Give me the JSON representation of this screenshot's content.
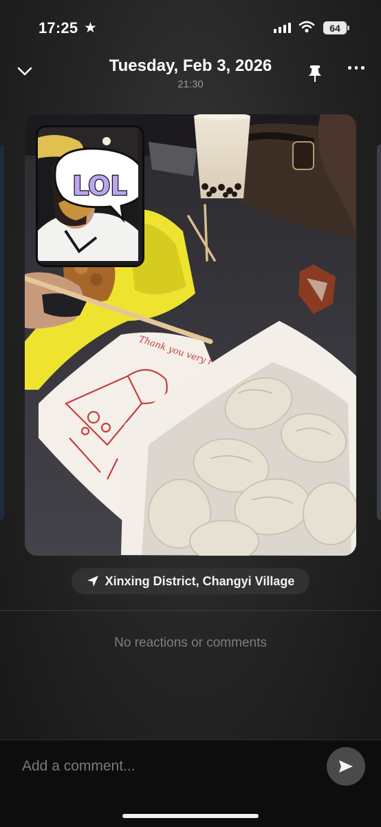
{
  "status_bar": {
    "time": "17:25",
    "battery": "64",
    "icons": [
      "star-icon",
      "signal-icon",
      "wifi-icon",
      "battery-icon"
    ]
  },
  "header": {
    "date": "Tuesday, Feb 3, 2026",
    "time": "21:30",
    "icons": [
      "chevron-down-icon",
      "pin-icon",
      "more-icon"
    ]
  },
  "photo": {
    "sticker_text": "LOL",
    "bag_text": "Thank you very much"
  },
  "location": {
    "icon": "location-arrow-icon",
    "label": "Xinxing District, Changyi Village"
  },
  "reactions": {
    "empty_text": "No reactions or comments"
  },
  "comment": {
    "placeholder": "Add a comment...",
    "send_icon": "send-icon"
  },
  "colors": {
    "background": "#222222",
    "pill": "#323232",
    "muted_text": "#7e7e7e",
    "send_button": "#4a4a4a",
    "sticker_text": "#b9a6f2"
  }
}
